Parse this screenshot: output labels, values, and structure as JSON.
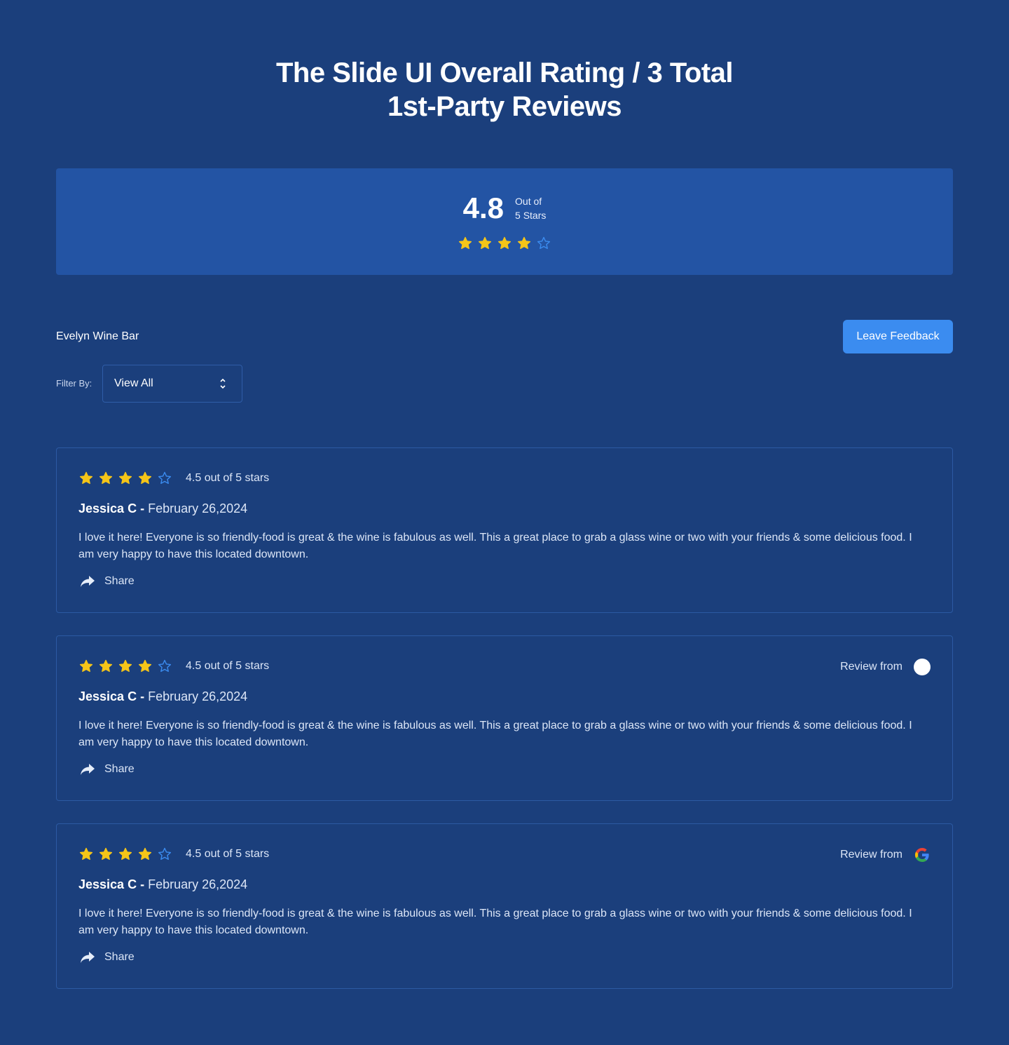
{
  "header": {
    "title_line1": "The Slide UI Overall Rating / 3 Total",
    "title_line2": "1st-Party Reviews"
  },
  "summary": {
    "score": "4.8",
    "out_of_line1": "Out of",
    "out_of_line2": "5 Stars",
    "stars_filled": 4,
    "stars_total": 5
  },
  "business": {
    "name": "Evelyn Wine Bar"
  },
  "actions": {
    "leave_feedback": "Leave Feedback"
  },
  "filter": {
    "label": "Filter By:",
    "selected": "View All"
  },
  "colors": {
    "background": "#1b3f7c",
    "summary_panel": "#2354a4",
    "accent_button": "#3b8cf0",
    "star_filled": "#f5c518",
    "star_empty": "#3b8cf0"
  },
  "reviews": [
    {
      "stars_filled": 4,
      "rating_text": "4.5 out of 5 stars",
      "author": "Jessica C",
      "separator": " - ",
      "date": "February 26,2024",
      "body": "I love it here! Everyone is so friendly-food is great & the wine is fabulous as well. This a great place to grab a glass wine or two with your friends & some delicious food. I am very happy to have this located downtown.",
      "share_label": "Share"
    },
    {
      "stars_filled": 4,
      "rating_text": "4.5 out of 5 stars",
      "author": "Jessica C",
      "separator": " - ",
      "date": "February 26,2024",
      "body": "I love it here! Everyone is so friendly-food is great & the wine is fabulous as well. This a great place to grab a glass wine or two with your friends & some delicious food. I am very happy to have this located downtown.",
      "share_label": "Share",
      "source_label": "Review from",
      "source_icon": "blank-circle-icon"
    },
    {
      "stars_filled": 4,
      "rating_text": "4.5 out of 5 stars",
      "author": "Jessica C",
      "separator": " - ",
      "date": "February 26,2024",
      "body": "I love it here! Everyone is so friendly-food is great & the wine is fabulous as well. This a great place to grab a glass wine or two with your friends & some delicious food. I am very happy to have this located downtown.",
      "share_label": "Share",
      "source_label": "Review from",
      "source_icon": "google-icon"
    }
  ]
}
